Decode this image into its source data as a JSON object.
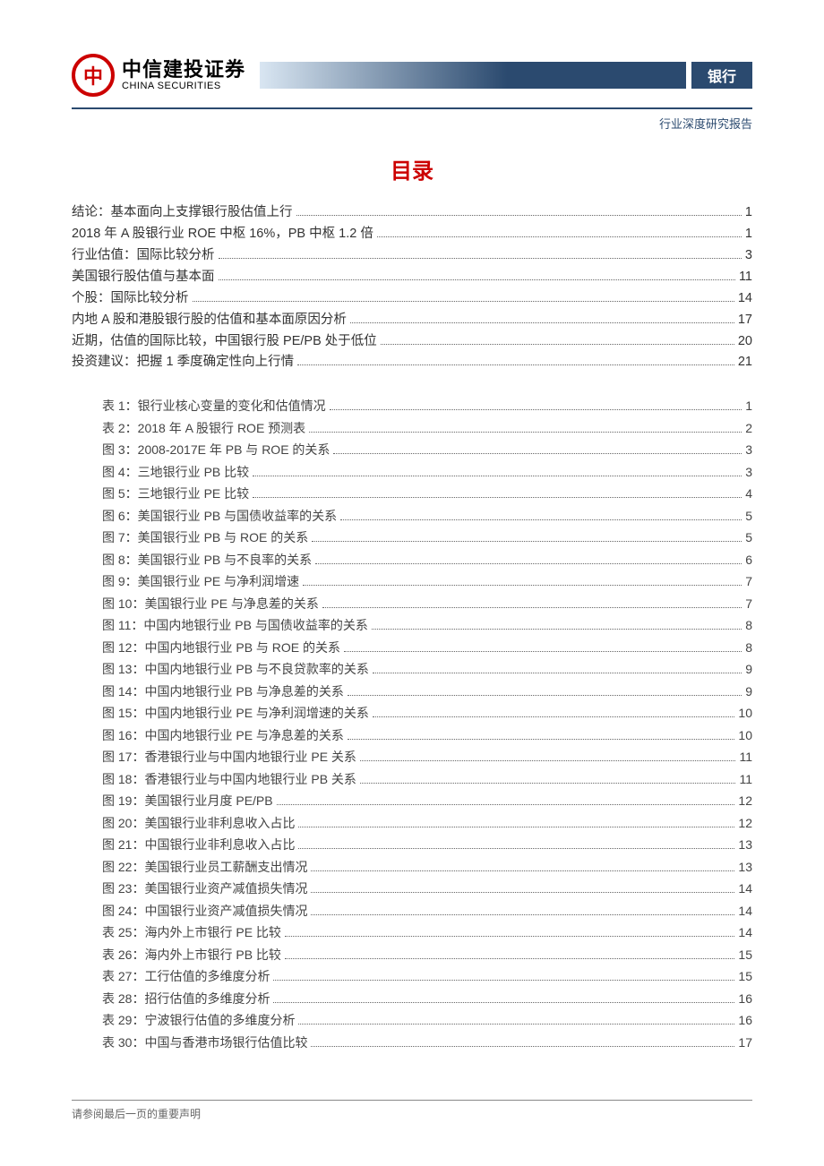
{
  "header": {
    "logo_char": "中",
    "company_cn": "中信建投证券",
    "company_en": "CHINA SECURITIES",
    "badge": "银行",
    "subtitle": "行业深度研究报告"
  },
  "toc_title": "目录",
  "toc_main": [
    {
      "label": "结论：基本面向上支撑银行股估值上行",
      "page": "1"
    },
    {
      "label": "2018 年 A 股银行业 ROE 中枢 16%，PB 中枢 1.2 倍",
      "page": "1"
    },
    {
      "label": "行业估值：国际比较分析",
      "page": "3"
    },
    {
      "label": "美国银行股估值与基本面",
      "page": "11"
    },
    {
      "label": "个股：国际比较分析",
      "page": "14"
    },
    {
      "label": "内地 A 股和港股银行股的估值和基本面原因分析",
      "page": "17"
    },
    {
      "label": "近期，估值的国际比较，中国银行股 PE/PB 处于低位",
      "page": "20"
    },
    {
      "label": "投资建议：把握 1 季度确定性向上行情",
      "page": "21"
    }
  ],
  "toc_sub": [
    {
      "label": "表 1：银行业核心变量的变化和估值情况",
      "page": "1"
    },
    {
      "label": "表 2：2018 年 A 股银行 ROE 预测表",
      "page": "2"
    },
    {
      "label": "图 3：2008-2017E 年 PB 与 ROE 的关系",
      "page": "3"
    },
    {
      "label": "图 4：三地银行业 PB 比较",
      "page": "3"
    },
    {
      "label": "图 5：三地银行业 PE 比较",
      "page": "4"
    },
    {
      "label": "图 6：美国银行业 PB 与国债收益率的关系",
      "page": "5"
    },
    {
      "label": "图 7：美国银行业 PB 与 ROE 的关系",
      "page": "5"
    },
    {
      "label": "图 8：美国银行业 PB 与不良率的关系",
      "page": "6"
    },
    {
      "label": "图 9：美国银行业 PE 与净利润增速",
      "page": "7"
    },
    {
      "label": "图 10：美国银行业 PE 与净息差的关系",
      "page": "7"
    },
    {
      "label": "图 11：中国内地银行业 PB 与国债收益率的关系",
      "page": "8"
    },
    {
      "label": "图 12：中国内地银行业 PB 与 ROE 的关系",
      "page": "8"
    },
    {
      "label": "图 13：中国内地银行业 PB 与不良贷款率的关系",
      "page": "9"
    },
    {
      "label": "图 14：中国内地银行业 PB 与净息差的关系",
      "page": "9"
    },
    {
      "label": "图 15：中国内地银行业 PE 与净利润增速的关系",
      "page": "10"
    },
    {
      "label": "图 16：中国内地银行业 PE 与净息差的关系",
      "page": "10"
    },
    {
      "label": "图 17：香港银行业与中国内地银行业 PE 关系",
      "page": "11"
    },
    {
      "label": "图 18：香港银行业与中国内地银行业 PB 关系",
      "page": "11"
    },
    {
      "label": "图 19：美国银行业月度 PE/PB",
      "page": "12"
    },
    {
      "label": "图 20：美国银行业非利息收入占比",
      "page": "12"
    },
    {
      "label": "图 21：中国银行业非利息收入占比",
      "page": "13"
    },
    {
      "label": "图 22：美国银行业员工薪酬支出情况",
      "page": "13"
    },
    {
      "label": "图 23：美国银行业资产减值损失情况",
      "page": "14"
    },
    {
      "label": "图 24：中国银行业资产减值损失情况",
      "page": "14"
    },
    {
      "label": "表 25：海内外上市银行 PE 比较",
      "page": "14"
    },
    {
      "label": "表 26：海内外上市银行 PB 比较",
      "page": "15"
    },
    {
      "label": "表 27：工行估值的多维度分析",
      "page": "15"
    },
    {
      "label": "表 28：招行估值的多维度分析",
      "page": "16"
    },
    {
      "label": "表 29：宁波银行估值的多维度分析",
      "page": "16"
    },
    {
      "label": "表 30：中国与香港市场银行估值比较",
      "page": "17"
    }
  ],
  "footer": "请参阅最后一页的重要声明"
}
